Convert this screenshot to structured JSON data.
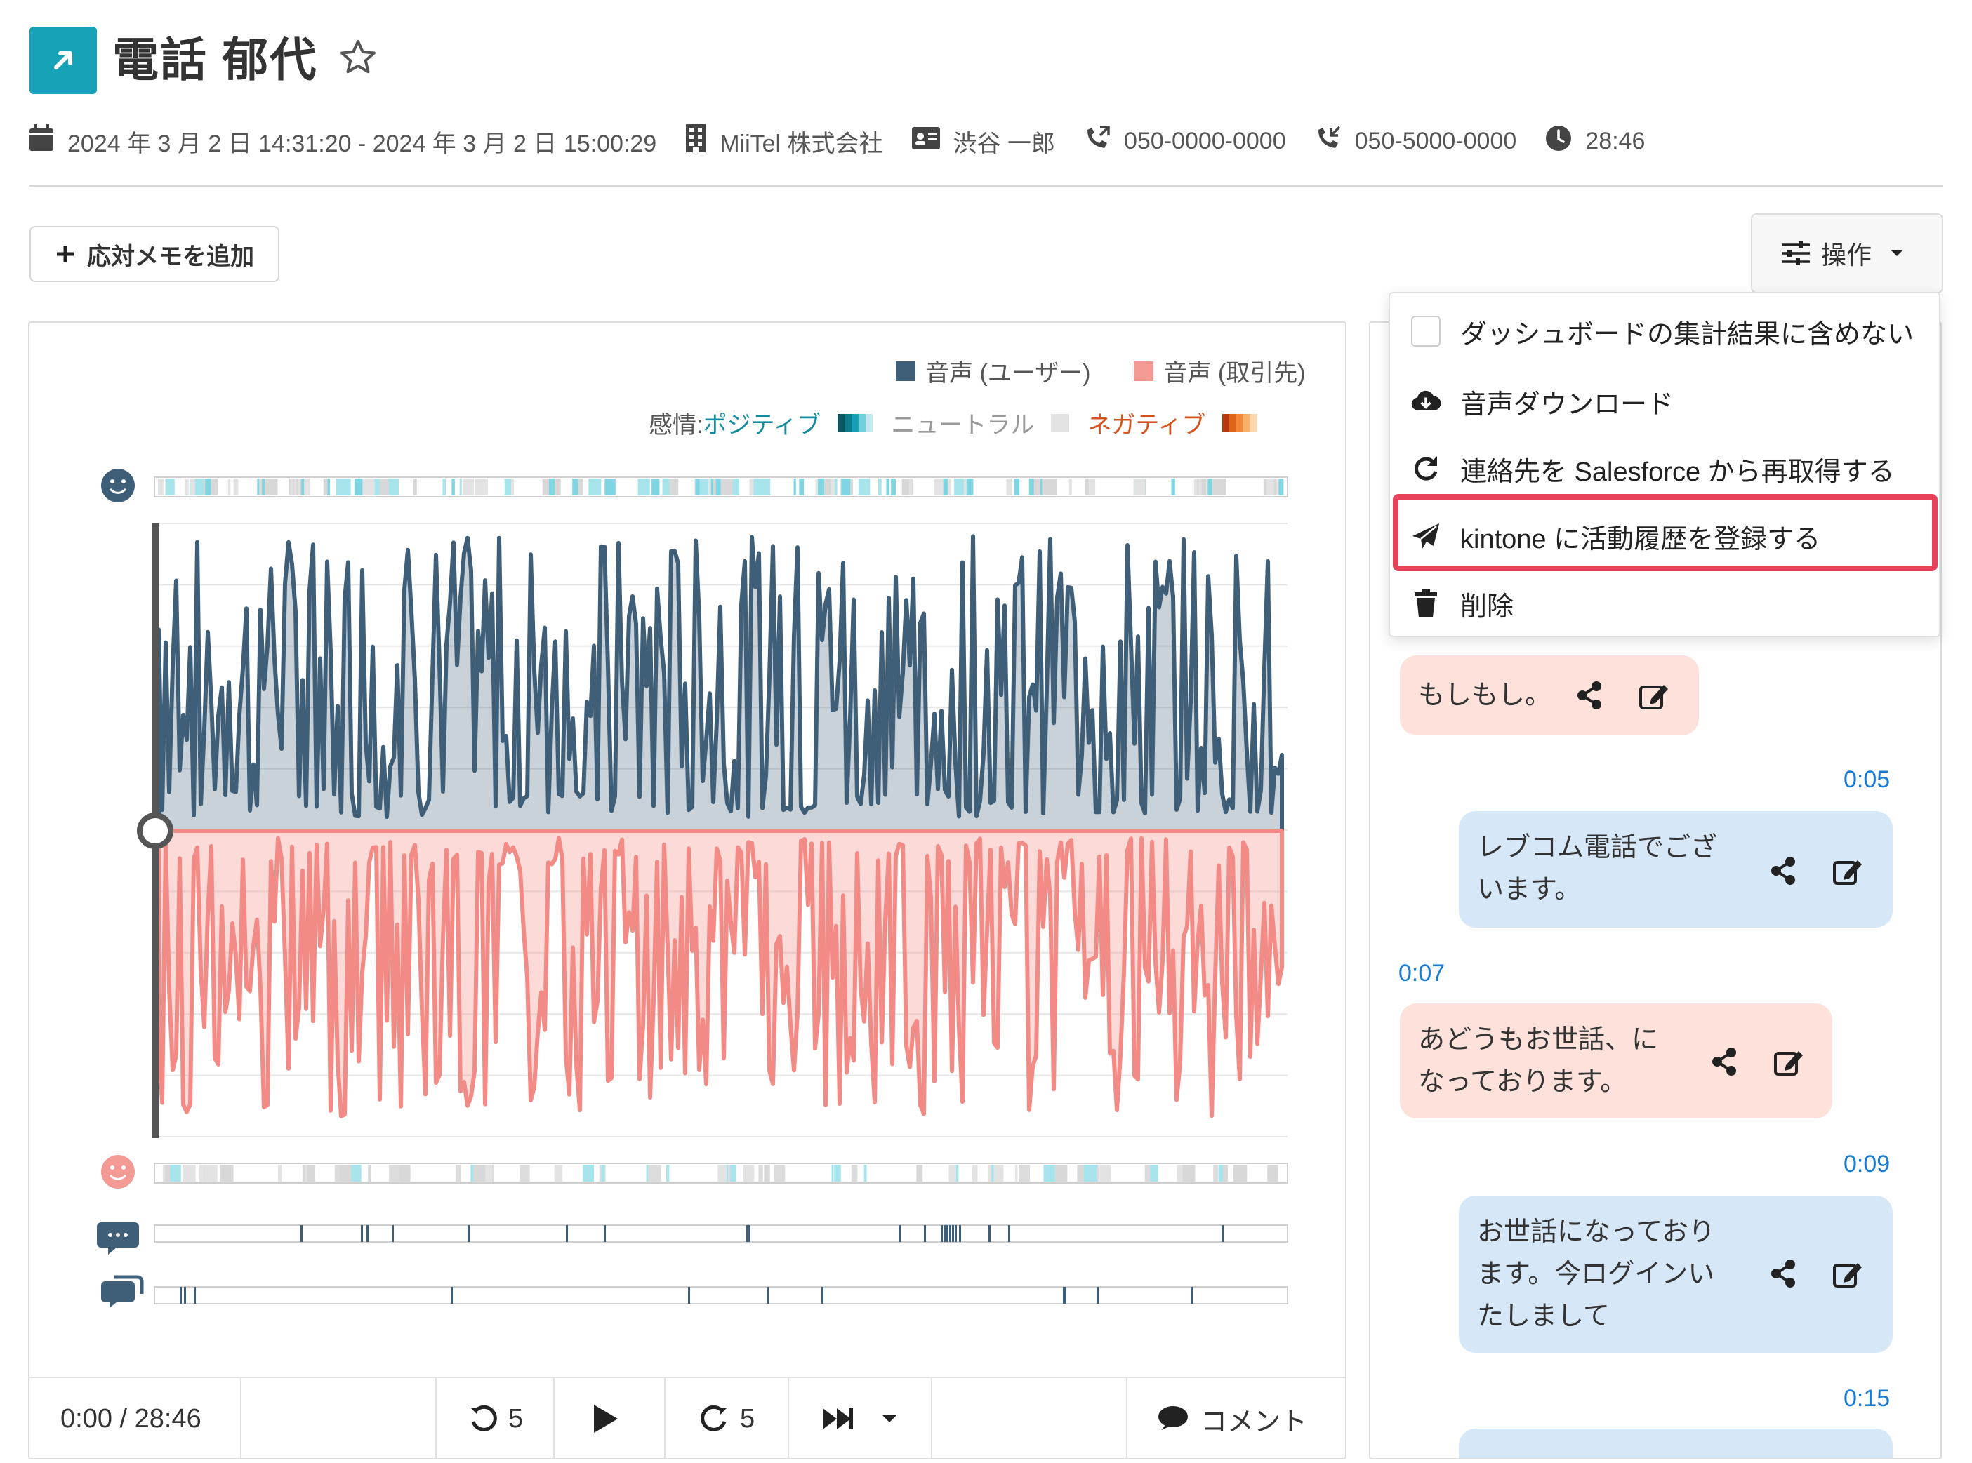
{
  "header": {
    "title": "電話 郁代",
    "meta": {
      "datetime": "2024 年 3 月 2 日 14:31:20 - 2024 年 3 月 2 日 15:00:29",
      "company": "MiiTel 株式会社",
      "contact": "渋谷 一郎",
      "phone_from": "050-0000-0000",
      "phone_to": "050-5000-0000",
      "duration": "28:46"
    }
  },
  "toolbar": {
    "memo_label": "応対メモを追加",
    "ops_label": "操作"
  },
  "legend": {
    "user": "音声 (ユーザー)",
    "client": "音声 (取引先)",
    "emotion_prefix": "感情:",
    "positive": "ポジティブ",
    "neutral": "ニュートラル",
    "negative": "ネガティブ"
  },
  "colors": {
    "user": "#3f5e78",
    "client": "#f28b86",
    "positive": "#17a2b8",
    "negative": "#e0631a",
    "accent_highlight": "#e8425a",
    "timestamp": "#1a7bd3"
  },
  "player": {
    "time": "0:00 / 28:46",
    "rewind": "5",
    "forward": "5",
    "comment": "コメント"
  },
  "menu": {
    "items": [
      {
        "label": "ダッシュボードの集計結果に含めない",
        "icon": "checkbox"
      },
      {
        "label": "音声ダウンロード",
        "icon": "cloud-download-icon"
      },
      {
        "label": "連絡先を Salesforce から再取得する",
        "icon": "refresh-icon"
      },
      {
        "label": "kintone に活動履歴を登録する",
        "icon": "paper-plane-icon"
      },
      {
        "label": "削除",
        "icon": "trash-icon"
      }
    ]
  },
  "transcript": [
    {
      "speaker": "client",
      "text": "もしもし。",
      "time": ""
    },
    {
      "speaker": "user",
      "text": "レブコム電話でござ\nいます。",
      "time": "0:05"
    },
    {
      "speaker": "client",
      "text": "あどうもお世話、に\nなっております。",
      "time": "0:07"
    },
    {
      "speaker": "user",
      "text": "お世話になっており\nます。今ログインい\nたしまして",
      "time": "0:09"
    },
    {
      "speaker": "user",
      "text": "",
      "time": "0:15"
    }
  ],
  "chart_data": {
    "type": "area",
    "title": "",
    "series": [
      {
        "name": "音声 (ユーザー)"
      },
      {
        "name": "音声 (取引先)"
      }
    ],
    "note": "mirrored audio amplitude waveform; user above baseline, client below"
  }
}
